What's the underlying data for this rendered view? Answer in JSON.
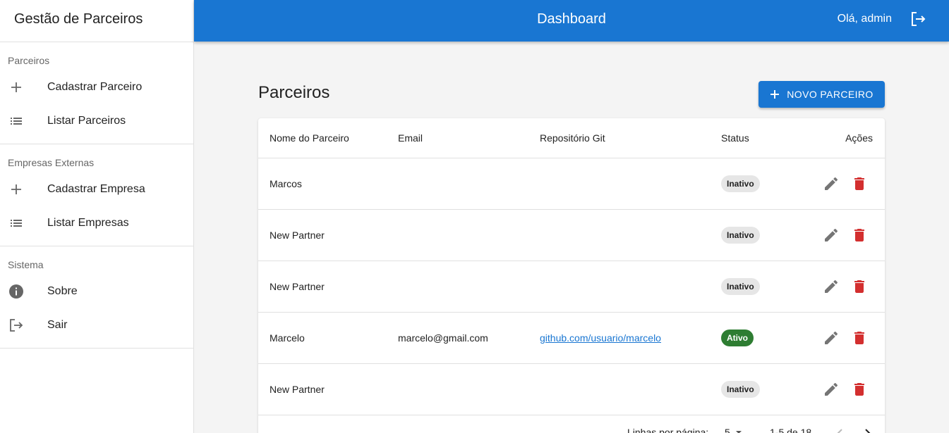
{
  "sidebar": {
    "title": "Gestão de Parceiros",
    "sections": [
      {
        "label": "Parceiros",
        "items": [
          {
            "label": "Cadastrar Parceiro",
            "icon": "plus-icon"
          },
          {
            "label": "Listar Parceiros",
            "icon": "list-icon"
          }
        ]
      },
      {
        "label": "Empresas Externas",
        "items": [
          {
            "label": "Cadastrar Empresa",
            "icon": "plus-icon"
          },
          {
            "label": "Listar Empresas",
            "icon": "list-icon"
          }
        ]
      },
      {
        "label": "Sistema",
        "items": [
          {
            "label": "Sobre",
            "icon": "info-icon"
          },
          {
            "label": "Sair",
            "icon": "logout-icon"
          }
        ]
      }
    ]
  },
  "header": {
    "title": "Dashboard",
    "greeting": "Olá, admin",
    "color": "#1976d2"
  },
  "main": {
    "title": "Parceiros",
    "new_button": "NOVO PARCEIRO"
  },
  "table": {
    "columns": [
      "Nome do Parceiro",
      "Email",
      "Repositório Git",
      "Status",
      "Ações"
    ],
    "rows": [
      {
        "name": "Marcos",
        "email": "",
        "repo": "",
        "status": "Inativo"
      },
      {
        "name": "New Partner",
        "email": "",
        "repo": "",
        "status": "Inativo"
      },
      {
        "name": "New Partner",
        "email": "",
        "repo": "",
        "status": "Inativo"
      },
      {
        "name": "Marcelo",
        "email": "marcelo@gmail.com",
        "repo": "github.com/usuario/marcelo",
        "status": "Ativo"
      },
      {
        "name": "New Partner",
        "email": "",
        "repo": "",
        "status": "Inativo"
      }
    ]
  },
  "pagination": {
    "rows_per_page_label": "Linhas por página:",
    "rows_per_page_value": "5",
    "range": "1-5 de 18"
  },
  "colors": {
    "primary": "#1976d2",
    "delete": "#d32f2f",
    "active_chip": "#2e7d32",
    "inactive_chip": "#e6e6e6"
  }
}
